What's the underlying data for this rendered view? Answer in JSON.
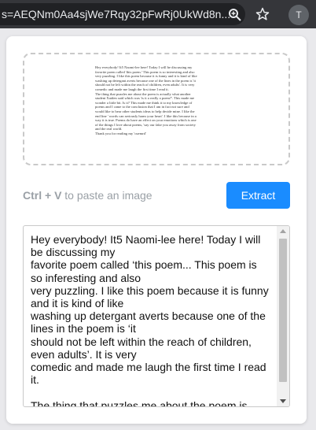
{
  "browser": {
    "url": "s=AEQNm0Aa4sjWe7Rqy32pFwRj0UkWd8n...",
    "profile_initial": "T",
    "icons": [
      "zoom-icon",
      "star-icon"
    ]
  },
  "panel": {
    "preview_lines": "Hey everybody! It5 Naomi-lee here! Today I will be discussing my\nfavorite poem called 'this poem.' This poem is so interesting and also\nvery puzzling. I like this poem because it is funny and it is kind of like\nwashing up detergant averts because one of the lines in the poem is 'it\nshould not be left within the reach of children, even adults'. It is very\ncomedic and made me laugh the first time I read it.\nThe thing that puzzles me about the poem is actually what another\nstudent Xaiden said which was 'is it a really a poem?'. This made me\nwonder a little bit. Is it? This made me think it to my knowledge of\npoems and I came to the conclusion that I am in fact not sure and\nwould like to hear other students ideas to help decide mine. I like the\nend line ' words can seriously harm your heart'. I like this because in a\nway it is true. Poems do have an effect on your emotions which is one\nof the things I love about poems, 'say our fake you away from society\nand the real world.\nThank you for reading my 'cuemrd'",
    "hint_shortcut": "Ctrl + V",
    "hint_text": " to paste an image",
    "extract_label": "Extract",
    "output_text": "Hey everybody! It5 Naomi-lee here! Today I will be discussing my\nfavorite poem called ‘this poem... This poem is so inferesting and also\nvery puzzling. I like this poem because it is funny and it is kind of like\nwashing up detergant averts because one of the lines in the poem is ‘it\nshould not be left within the reach of children, even adults’. It is very\ncomedic and made me laugh the first time I read it.\n\nThe thing that puzzles me about the poem is"
  },
  "colors": {
    "accent": "#1a8cff",
    "topbar": "#35363a"
  }
}
